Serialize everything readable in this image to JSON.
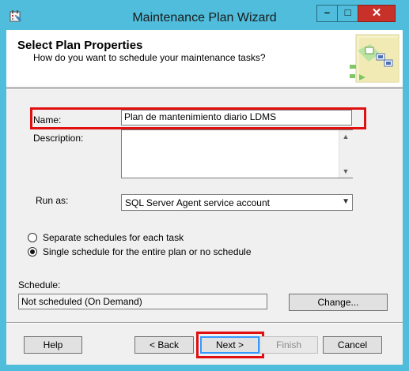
{
  "window": {
    "title": "Maintenance Plan Wizard"
  },
  "header": {
    "title": "Select Plan Properties",
    "subtitle": "How do you want to schedule your maintenance tasks?"
  },
  "form": {
    "name_label": "Name:",
    "name_value": "Plan de mantenimiento diario LDMS",
    "description_label": "Description:",
    "description_value": "",
    "run_as_label": "Run as:",
    "run_as_value": "SQL Server Agent service account",
    "radio_separate": "Separate schedules for each task",
    "radio_single": "Single schedule for the entire plan or no schedule",
    "selected_option": "single",
    "schedule_label": "Schedule:",
    "schedule_value": "Not scheduled (On Demand)",
    "change_button": "Change..."
  },
  "footer": {
    "help": "Help",
    "back": "< Back",
    "next": "Next >",
    "finish": "Finish",
    "cancel": "Cancel"
  },
  "colors": {
    "title_bar": "#4fbddb",
    "close_button": "#c7312a",
    "highlight": "#e01010"
  }
}
